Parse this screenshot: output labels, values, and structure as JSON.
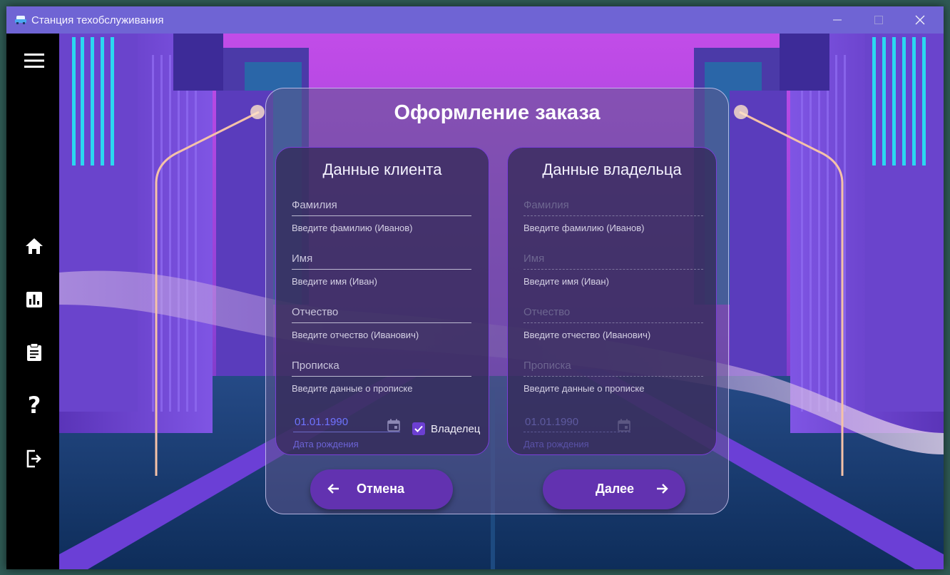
{
  "window": {
    "title": "Станция техобслуживания",
    "minimize_icon": "minimize-icon",
    "maximize_icon": "maximize-icon",
    "close_icon": "close-icon"
  },
  "sidebar": {
    "items": [
      {
        "name": "menu",
        "icon": "hamburger-menu-icon"
      },
      {
        "name": "home",
        "icon": "home-icon"
      },
      {
        "name": "statistics",
        "icon": "bar-chart-icon"
      },
      {
        "name": "orders",
        "icon": "clipboard-icon"
      },
      {
        "name": "help",
        "icon": "question-mark-icon"
      },
      {
        "name": "logout",
        "icon": "exit-icon"
      }
    ]
  },
  "form": {
    "title": "Оформление заказа",
    "client": {
      "title": "Данные клиента",
      "surname_label": "Фамилия",
      "surname_hint": "Введите фамилию (Иванов)",
      "name_label": "Имя",
      "name_hint": "Введите имя (Иван)",
      "patronymic_label": "Отчество",
      "patronymic_hint": "Введите отчество (Иванович)",
      "registration_label": "Прописка",
      "registration_hint": "Введите данные о прописке",
      "birth_date": "01.01.1990",
      "birth_date_caption": "Дата рождения",
      "owner_checkbox_label": "Владелец",
      "owner_checked": true
    },
    "owner": {
      "title": "Данные владельца",
      "surname_label": "Фамилия",
      "surname_hint": "Введите фамилию (Иванов)",
      "name_label": "Имя",
      "name_hint": "Введите имя (Иван)",
      "patronymic_label": "Отчество",
      "patronymic_hint": "Введите отчество (Иванович)",
      "registration_label": "Прописка",
      "registration_hint": "Введите данные о прописке",
      "birth_date": "01.01.1990",
      "birth_date_caption": "Дата рождения",
      "disabled": true
    },
    "cancel_label": "Отмена",
    "next_label": "Далее"
  },
  "colors": {
    "titlebar": "#6f64d4",
    "accent": "#6232b0",
    "card_border": "#7a3ed8",
    "date_text": "#6e74ff"
  }
}
